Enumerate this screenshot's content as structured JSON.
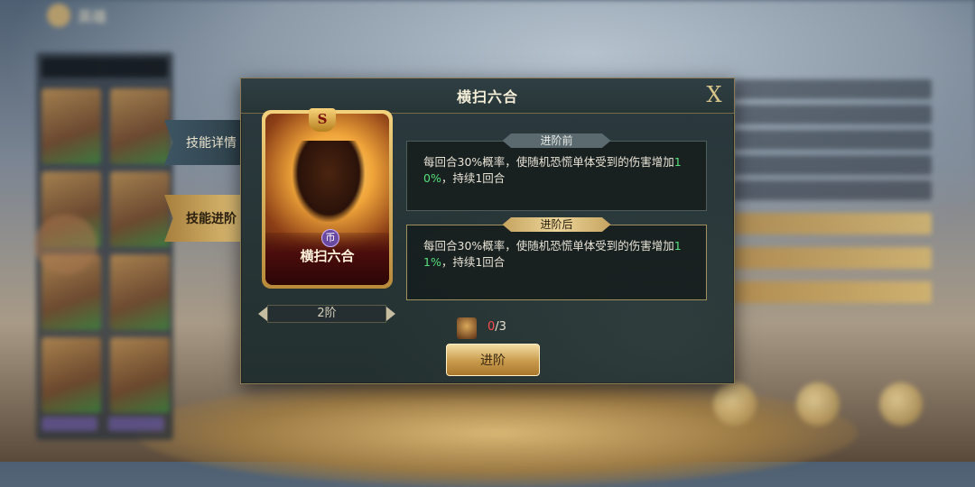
{
  "header": {
    "back_label": "英雄"
  },
  "dialog": {
    "title": "横扫六合",
    "close_label": "X"
  },
  "tabs": [
    {
      "label": "技能详情"
    },
    {
      "label": "技能进阶"
    }
  ],
  "card": {
    "grade": "S",
    "name": "横扫六合",
    "rune": "币"
  },
  "level": {
    "label": "2阶"
  },
  "before": {
    "label": "进阶前",
    "text_part1": "每回合30%概率，使随机恐慌单体受到的伤害增加",
    "highlight": "10%",
    "text_part2": "，持续1回合"
  },
  "after": {
    "label": "进阶后",
    "text_part1": "每回合30%概率，使随机恐慌单体受到的伤害增加",
    "highlight": "11%",
    "text_part2": "，持续1回合"
  },
  "cost": {
    "have": "0",
    "need": "/3"
  },
  "advance_button": {
    "label": "进阶"
  },
  "colors": {
    "accent_gold": "#e6c77e",
    "highlight_green": "#57e07c",
    "insufficient_red": "#ff4a4a"
  }
}
